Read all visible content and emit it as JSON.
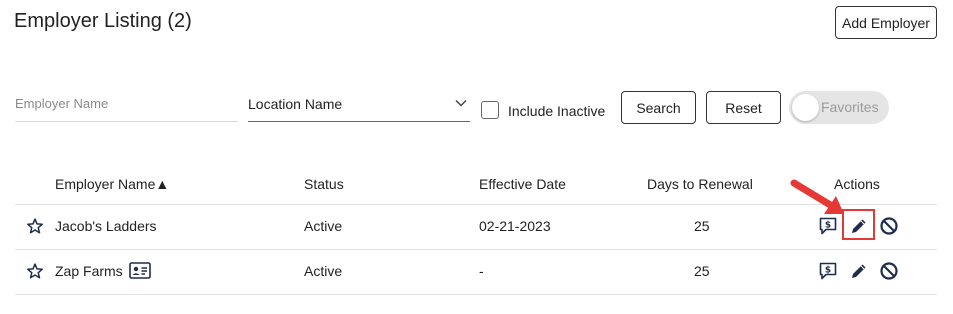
{
  "header": {
    "title": "Employer Listing (2)",
    "add_button": "Add Employer"
  },
  "filters": {
    "employer_name_placeholder": "Employer Name",
    "location_label": "Location Name",
    "include_inactive_label": "Include Inactive",
    "include_inactive_checked": false,
    "search_button": "Search",
    "reset_button": "Reset",
    "favorites_label": "Favorites",
    "favorites_on": false
  },
  "table": {
    "columns": {
      "employer_name": "Employer Name",
      "sort_indicator": "▲",
      "status": "Status",
      "effective_date": "Effective Date",
      "days_to_renewal": "Days to Renewal",
      "actions": "Actions"
    },
    "rows": [
      {
        "name": "Jacob's Ladders",
        "status": "Active",
        "effective_date": "02-21-2023",
        "days_to_renewal": "25",
        "has_id_card": false
      },
      {
        "name": "Zap Farms",
        "status": "Active",
        "effective_date": "-",
        "days_to_renewal": "25",
        "has_id_card": true
      }
    ]
  },
  "icons": {
    "star": "star-outline-icon",
    "id_card": "id-card-icon",
    "billing": "dollar-chat-icon",
    "edit": "pencil-icon",
    "deactivate": "ban-icon",
    "chevron": "chevron-down-icon"
  },
  "colors": {
    "annotation_red": "#e53935",
    "icon_navy": "#1f2d4d",
    "select_underline": "#4a7c3a"
  }
}
